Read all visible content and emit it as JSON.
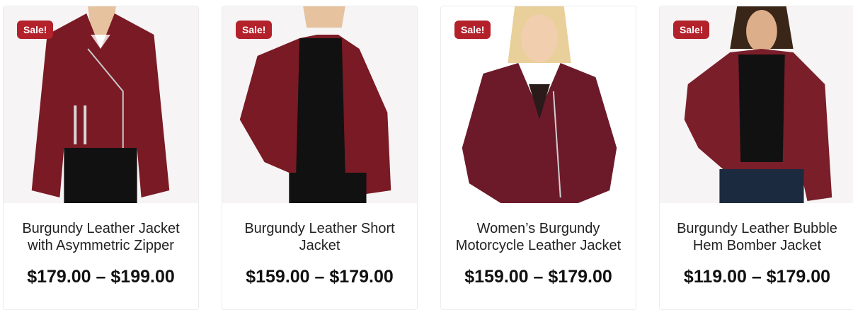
{
  "colors": {
    "sale_badge": "#b3212b",
    "jacket": "#7a1a24",
    "text": "#222222"
  },
  "products": [
    {
      "badge": "Sale!",
      "title": "Burgundy Leather Jacket with Asymmetric Zipper",
      "price": "$179.00 – $199.00"
    },
    {
      "badge": "Sale!",
      "title": "Burgundy Leather Short Jacket",
      "price": "$159.00 – $179.00"
    },
    {
      "badge": "Sale!",
      "title": "Women’s Burgundy Motorcycle Leather Jacket",
      "price": "$159.00 – $179.00"
    },
    {
      "badge": "Sale!",
      "title": "Burgundy Leather Bubble Hem Bomber Jacket",
      "price": "$119.00 – $179.00"
    }
  ]
}
